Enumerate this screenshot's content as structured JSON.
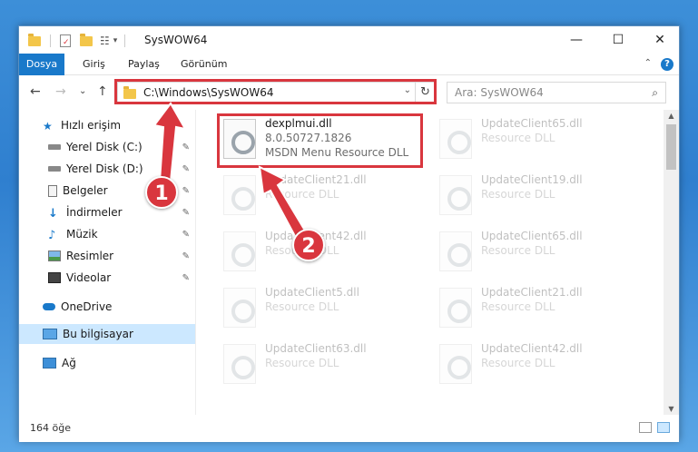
{
  "window": {
    "title": "SysWOW64",
    "minimize": "—",
    "maximize": "☐",
    "close": "✕"
  },
  "ribbon": {
    "tabs": [
      "Dosya",
      "Giriş",
      "Paylaş",
      "Görünüm"
    ],
    "help": "?",
    "collapse": "⌃"
  },
  "nav": {
    "back": "←",
    "forward": "→",
    "recent": "⌄",
    "up": "↑",
    "address": "C:\\Windows\\SysWOW64",
    "refresh": "↻",
    "dropdown": "⌄",
    "search_placeholder": "Ara: SysWOW64",
    "search_icon": "⌕"
  },
  "sidebar": {
    "items": [
      {
        "label": "Hızlı erişim",
        "icon": "star-icon",
        "pinned": false
      },
      {
        "label": "Yerel Disk (C:)",
        "icon": "drive-icon",
        "pinned": true
      },
      {
        "label": "Yerel Disk (D:)",
        "icon": "drive-icon",
        "pinned": true
      },
      {
        "label": "Belgeler",
        "icon": "documents-icon",
        "pinned": true
      },
      {
        "label": "İndirmeler",
        "icon": "download-icon",
        "pinned": true
      },
      {
        "label": "Müzik",
        "icon": "music-icon",
        "pinned": true
      },
      {
        "label": "Resimler",
        "icon": "pictures-icon",
        "pinned": true
      },
      {
        "label": "Videolar",
        "icon": "videos-icon",
        "pinned": true
      },
      {
        "label": "OneDrive",
        "icon": "cloud-icon",
        "pinned": false
      },
      {
        "label": "Bu bilgisayar",
        "icon": "computer-icon",
        "pinned": false
      },
      {
        "label": "Ağ",
        "icon": "network-icon",
        "pinned": false
      }
    ],
    "pin_glyph": "📌"
  },
  "files": [
    {
      "name": "dexplmui.dll",
      "version": "8.0.50727.1826",
      "desc": "MSDN Menu Resource DLL",
      "faded": false
    },
    {
      "name": "UpdateClient65.dll",
      "version": "Resource DLL",
      "desc": "",
      "faded": true
    },
    {
      "name": "UpdateClient21.dll",
      "version": "Resource DLL",
      "desc": "",
      "faded": true
    },
    {
      "name": "UpdateClient19.dll",
      "version": "Resource DLL",
      "desc": "",
      "faded": true
    },
    {
      "name": "UpdateClient42.dll",
      "version": "Resource DLL",
      "desc": "",
      "faded": true
    },
    {
      "name": "UpdateClient65.dll",
      "version": "Resource DLL",
      "desc": "",
      "faded": true
    },
    {
      "name": "UpdateClient5.dll",
      "version": "Resource DLL",
      "desc": "",
      "faded": true
    },
    {
      "name": "UpdateClient21.dll",
      "version": "Resource DLL",
      "desc": "",
      "faded": true
    },
    {
      "name": "UpdateClient63.dll",
      "version": "Resource DLL",
      "desc": "",
      "faded": true
    },
    {
      "name": "UpdateClient42.dll",
      "version": "Resource DLL",
      "desc": "",
      "faded": true
    }
  ],
  "status": {
    "count": "164 öğe"
  },
  "annotations": {
    "callout1": "1",
    "callout2": "2",
    "color": "#d9363e"
  }
}
